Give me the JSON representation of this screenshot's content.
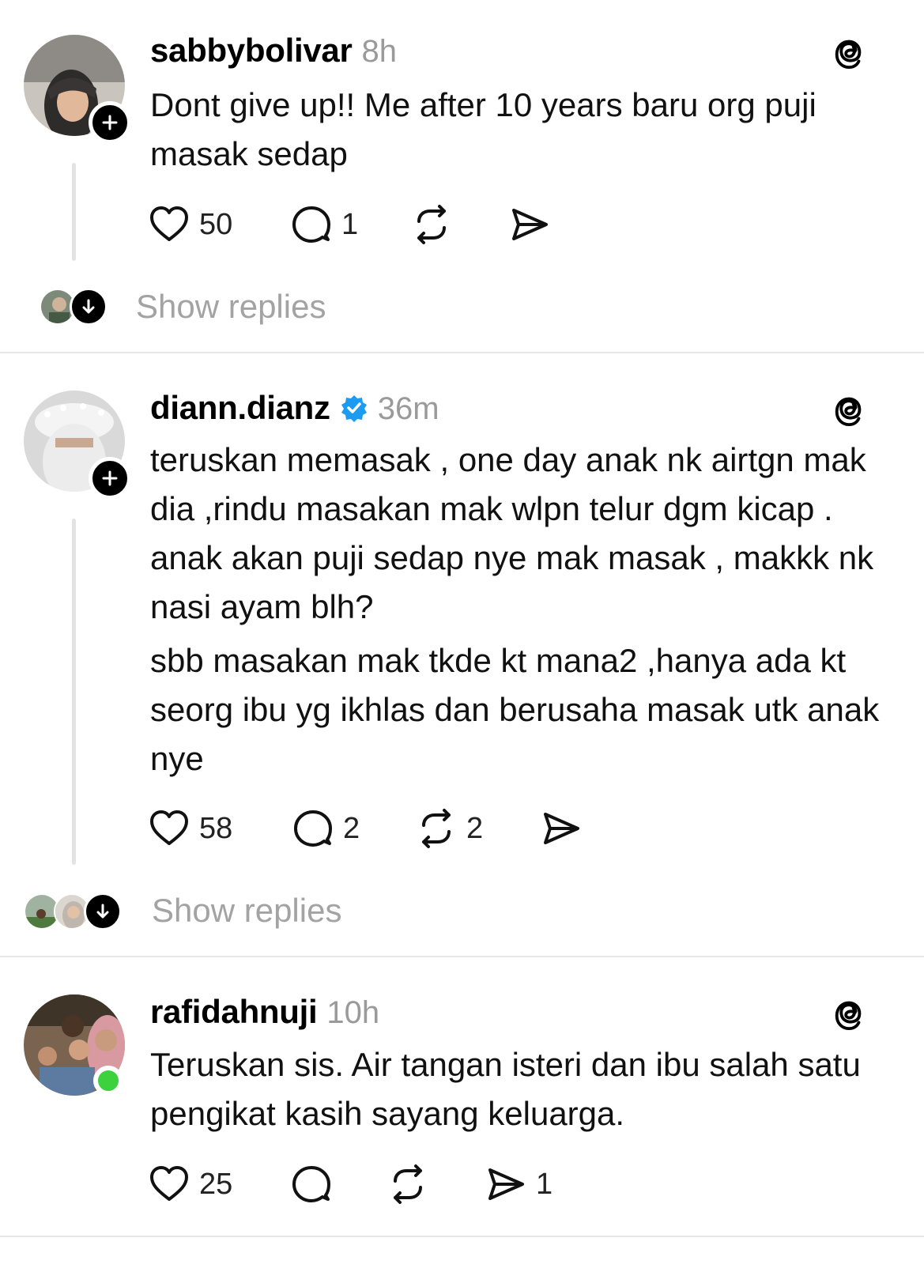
{
  "posts": [
    {
      "username": "sabbybolivar",
      "time": "8h",
      "verified": false,
      "paragraphs": [
        "Dont give up!! Me after 10 years baru org puji masak sedap"
      ],
      "likes": "50",
      "comments": "1",
      "reposts": "",
      "shares": "",
      "show_replies": "Show replies"
    },
    {
      "username": "diann.dianz",
      "time": "36m",
      "verified": true,
      "paragraphs": [
        "teruskan memasak , one day anak nk airtgn mak dia ,rindu masakan mak wlpn telur dgm kicap . anak akan puji sedap nye mak masak , makkk nk nasi ayam blh?",
        "sbb masakan mak tkde kt mana2 ,hanya ada kt seorg ibu yg ikhlas dan berusaha masak utk anak nye"
      ],
      "likes": "58",
      "comments": "2",
      "reposts": "2",
      "shares": "",
      "show_replies": "Show replies"
    },
    {
      "username": "rafidahnuji",
      "time": "10h",
      "verified": false,
      "paragraphs": [
        "Teruskan sis. Air tangan isteri dan ibu salah satu pengikat kasih sayang keluarga."
      ],
      "likes": "25",
      "comments": "",
      "reposts": "",
      "shares": "1"
    }
  ],
  "icons": {
    "like": "heart-icon",
    "comment": "comment-bubble-icon",
    "repost": "repost-icon",
    "share": "send-icon",
    "logo": "threads-logo-icon",
    "follow": "plus-icon",
    "expand": "arrow-down-icon",
    "verified": "verified-badge-icon"
  },
  "colors": {
    "verified": "#1d9bf0",
    "online": "#3ed13e",
    "muted_text": "#9a9a9a"
  }
}
